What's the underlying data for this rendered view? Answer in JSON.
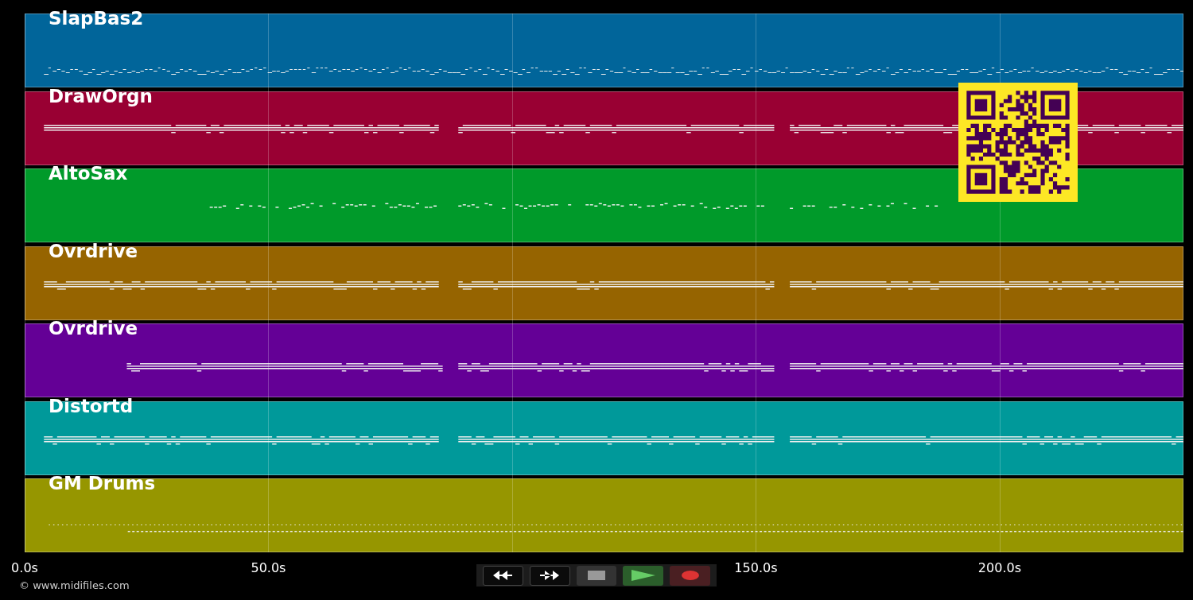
{
  "tracks": [
    {
      "name": "SlapBas2",
      "color": "#01659a"
    },
    {
      "name": "DrawOrgn",
      "color": "#990033"
    },
    {
      "name": "AltoSax",
      "color": "#009a2a"
    },
    {
      "name": "Ovrdrive",
      "color": "#966400"
    },
    {
      "name": "Ovrdrive",
      "color": "#640096"
    },
    {
      "name": "Distortd",
      "color": "#00999a"
    },
    {
      "name": "GM Drums",
      "color": "#969600"
    }
  ],
  "time_axis": {
    "ticks": [
      "0.0s",
      "50.0s",
      "150.0s",
      "200.0s"
    ]
  },
  "transport": {
    "buttons": [
      {
        "kind": "rewind"
      },
      {
        "kind": "forward"
      },
      {
        "kind": "stop"
      },
      {
        "kind": "play"
      },
      {
        "kind": "record"
      }
    ]
  },
  "copyright": "© www.midifiles.com"
}
